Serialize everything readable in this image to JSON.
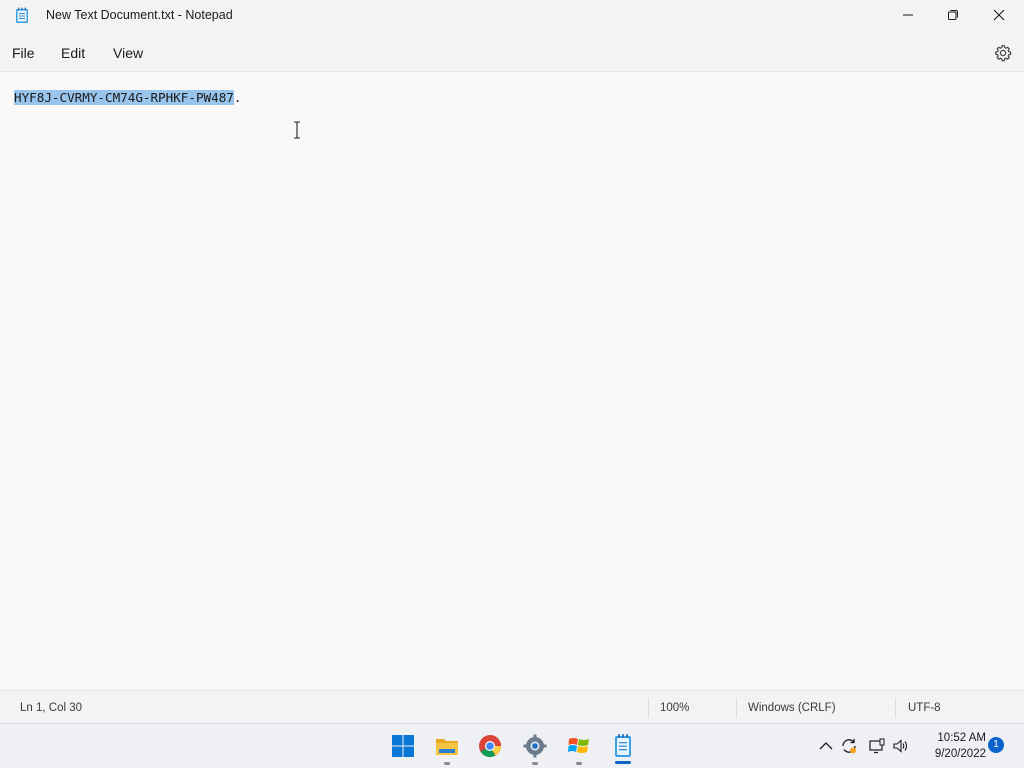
{
  "window": {
    "title": "New Text Document.txt - Notepad",
    "app_icon": "notepad-icon"
  },
  "menu": {
    "file": "File",
    "edit": "Edit",
    "view": "View",
    "settings_icon": "gear-icon"
  },
  "editor": {
    "selected_text": "HYF8J-CVRMY-CM74G-RPHKF-PW487",
    "trailing_text": ".",
    "selection_color": "#99c4ec"
  },
  "status": {
    "position": "Ln 1, Col 30",
    "zoom": "100%",
    "line_ending": "Windows (CRLF)",
    "encoding": "UTF-8"
  },
  "taskbar": {
    "apps": [
      {
        "name": "start",
        "icon": "windows-start-icon"
      },
      {
        "name": "file-explorer",
        "icon": "folder-icon"
      },
      {
        "name": "chrome",
        "icon": "chrome-icon"
      },
      {
        "name": "settings",
        "icon": "gear-icon"
      },
      {
        "name": "windows-xp-app",
        "icon": "windows-flag-icon"
      },
      {
        "name": "notepad",
        "icon": "notepad-icon",
        "active": true
      }
    ],
    "clock": {
      "time": "10:52 AM",
      "date": "9/20/2022"
    },
    "notification_count": "1",
    "accent_color": "#0a64c8"
  }
}
